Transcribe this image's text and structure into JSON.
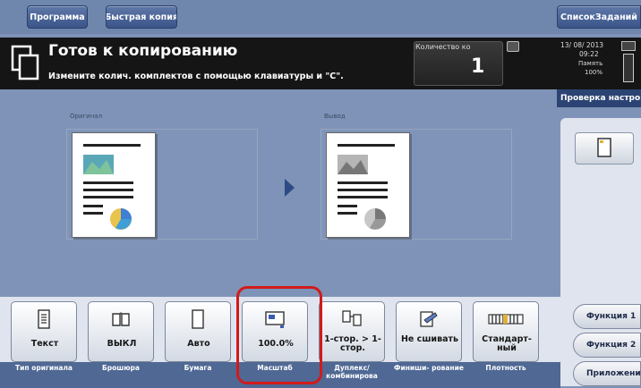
{
  "tabs": {
    "program": "Программа",
    "quick_copy": "Быстрая копия",
    "job_list": "СписокЗаданий"
  },
  "status": {
    "title": "Готов к копированию",
    "hint": "Измените колич. комплектов с помощью клавиатуры и \"C\"."
  },
  "quantity": {
    "label": "Количество ко",
    "value": "1"
  },
  "system": {
    "date": "13/ 08/ 2013",
    "time": "09:22",
    "memory_label": "Память",
    "memory": "100%"
  },
  "side": {
    "check_settings": "Проверка настро",
    "function1": "Функция 1",
    "function2": "Функция 2",
    "application": "Приложение"
  },
  "preview": {
    "original_label": "Оригинал",
    "output_label": "Вывод"
  },
  "functions": [
    {
      "value": "Текст",
      "caption": "Тип оригинала",
      "icon": "document-text-icon"
    },
    {
      "value": "ВЫКЛ",
      "caption": "Брошюра",
      "icon": "booklet-icon"
    },
    {
      "value": "Авто",
      "caption": "Бумага",
      "icon": "paper-icon"
    },
    {
      "value": "100.0%",
      "caption": "Масштаб",
      "icon": "zoom-icon"
    },
    {
      "value": "1-стор. > 1-стор.",
      "caption": "Дуплекс/ комбинирова",
      "icon": "duplex-icon"
    },
    {
      "value": "Не сшивать",
      "caption": "Финиши- рование",
      "icon": "finishing-icon"
    },
    {
      "value": "Стандарт- ный",
      "caption": "Плотность",
      "icon": "density-icon"
    }
  ],
  "colors": {
    "screen_bg": "#7e93b7",
    "status_bg": "#151515",
    "highlight": "#d21a1a",
    "accent_blue": "#2d4a86"
  }
}
